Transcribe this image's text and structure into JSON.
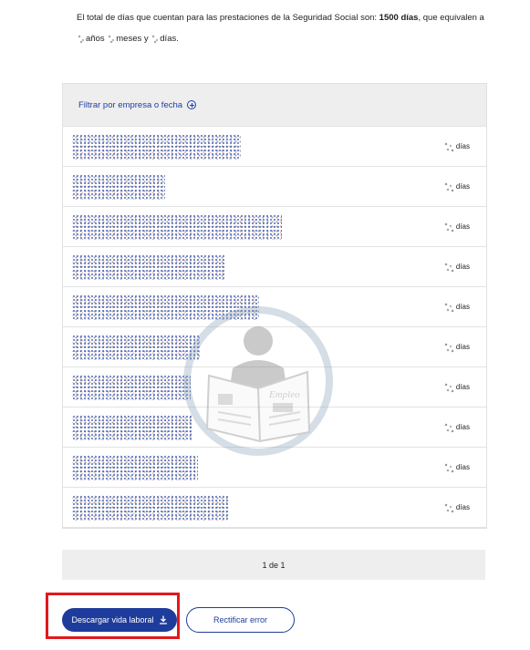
{
  "summary": {
    "line1_prefix": "El total de días que cuentan para las prestaciones de la Seguridad Social son: ",
    "line1_total": "1500 días",
    "line1_suffix": ", que equivalen a",
    "years_label": "años",
    "months_label": "meses y",
    "days_label": "días."
  },
  "filter": {
    "label": "Filtrar por empresa o fecha",
    "icon": "plus-circle-icon"
  },
  "rows": [
    {
      "days_suffix": "días"
    },
    {
      "days_suffix": "días"
    },
    {
      "days_suffix": "días"
    },
    {
      "days_suffix": "días"
    },
    {
      "days_suffix": "días"
    },
    {
      "days_suffix": "días"
    },
    {
      "days_suffix": "días"
    },
    {
      "days_suffix": "días"
    },
    {
      "days_suffix": "días"
    },
    {
      "days_suffix": "días"
    }
  ],
  "pagination": {
    "label": "1 de 1"
  },
  "actions": {
    "download_label": "Descargar vida laboral",
    "download_icon": "download-icon",
    "rectify_label": "Rectificar error"
  },
  "watermark": {
    "text": "Empleo"
  },
  "colors": {
    "primary": "#1e3c9c",
    "link": "#1c3faa",
    "highlight": "#e0191d",
    "panel_bg": "#eeeeee"
  }
}
